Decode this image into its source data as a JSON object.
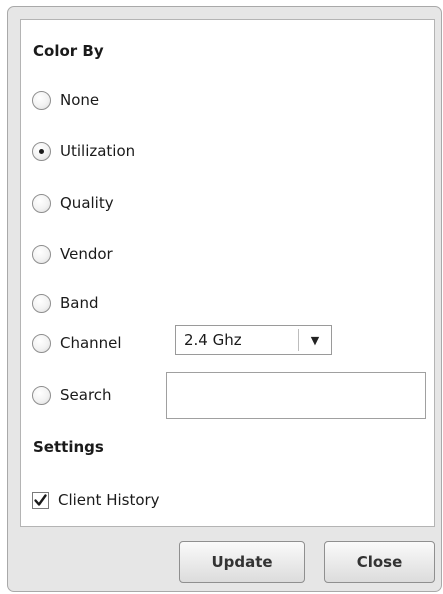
{
  "color_by": {
    "title": "Color By",
    "options": [
      {
        "label": "None",
        "selected": false
      },
      {
        "label": "Utilization",
        "selected": true
      },
      {
        "label": "Quality",
        "selected": false
      },
      {
        "label": "Vendor",
        "selected": false
      },
      {
        "label": "Band",
        "selected": false
      },
      {
        "label": "Channel",
        "selected": false
      },
      {
        "label": "Search",
        "selected": false
      }
    ],
    "channel_select": {
      "value": "2.4 Ghz",
      "arrow": "▼"
    },
    "search_input": {
      "value": ""
    }
  },
  "settings": {
    "title": "Settings",
    "client_history": {
      "label": "Client History",
      "checked": true
    }
  },
  "buttons": {
    "update_label": "Update",
    "close_label": "Close"
  }
}
